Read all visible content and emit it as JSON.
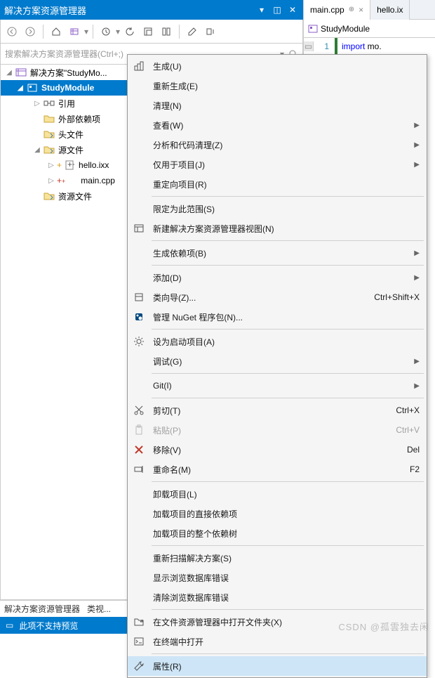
{
  "panel": {
    "title": "解决方案资源管理器",
    "search_placeholder": "搜索解决方案资源管理器(Ctrl+;)",
    "bottom_tabs": [
      "解决方案资源管理器",
      "类视..."
    ],
    "preview_msg": "此项不支持预览"
  },
  "tree": {
    "solution": "解决方案\"StudyMo...",
    "project": "StudyModule",
    "nodes": {
      "refs": "引用",
      "ext_deps": "外部依赖项",
      "headers": "头文件",
      "sources": "源文件",
      "hello": "hello.ixx",
      "main": "main.cpp",
      "resources": "资源文件"
    }
  },
  "editor": {
    "tabs": [
      "main.cpp",
      "hello.ix"
    ],
    "drop": "StudyModule",
    "line_no": "1",
    "code_kw": "import",
    "code_rest": " mo."
  },
  "menu": {
    "build": "生成(U)",
    "rebuild": "重新生成(E)",
    "clean": "清理(N)",
    "view": "查看(W)",
    "analyze": "分析和代码清理(Z)",
    "project_only": "仅用于项目(J)",
    "retarget": "重定向项目(R)",
    "scope": "限定为此范围(S)",
    "new_view": "新建解决方案资源管理器视图(N)",
    "build_deps": "生成依赖项(B)",
    "add": "添加(D)",
    "class_wizard": "类向导(Z)...",
    "nuget": "管理 NuGet 程序包(N)...",
    "startup": "设为启动项目(A)",
    "debug": "调试(G)",
    "git": "Git(I)",
    "cut": "剪切(T)",
    "paste": "粘贴(P)",
    "remove": "移除(V)",
    "rename": "重命名(M)",
    "unload": "卸载项目(L)",
    "load_deps": "加载项目的直接依赖项",
    "load_tree": "加载项目的整个依赖树",
    "rescan": "重新扫描解决方案(S)",
    "show_browse_err": "显示浏览数据库错误",
    "clear_browse_err": "清除浏览数据库错误",
    "open_folder": "在文件资源管理器中打开文件夹(X)",
    "open_terminal": "在终端中打开",
    "properties": "属性(R)",
    "sc_class_wizard": "Ctrl+Shift+X",
    "sc_cut": "Ctrl+X",
    "sc_paste": "Ctrl+V",
    "sc_remove": "Del",
    "sc_rename": "F2"
  },
  "watermark": "CSDN @孤雲独去闲"
}
